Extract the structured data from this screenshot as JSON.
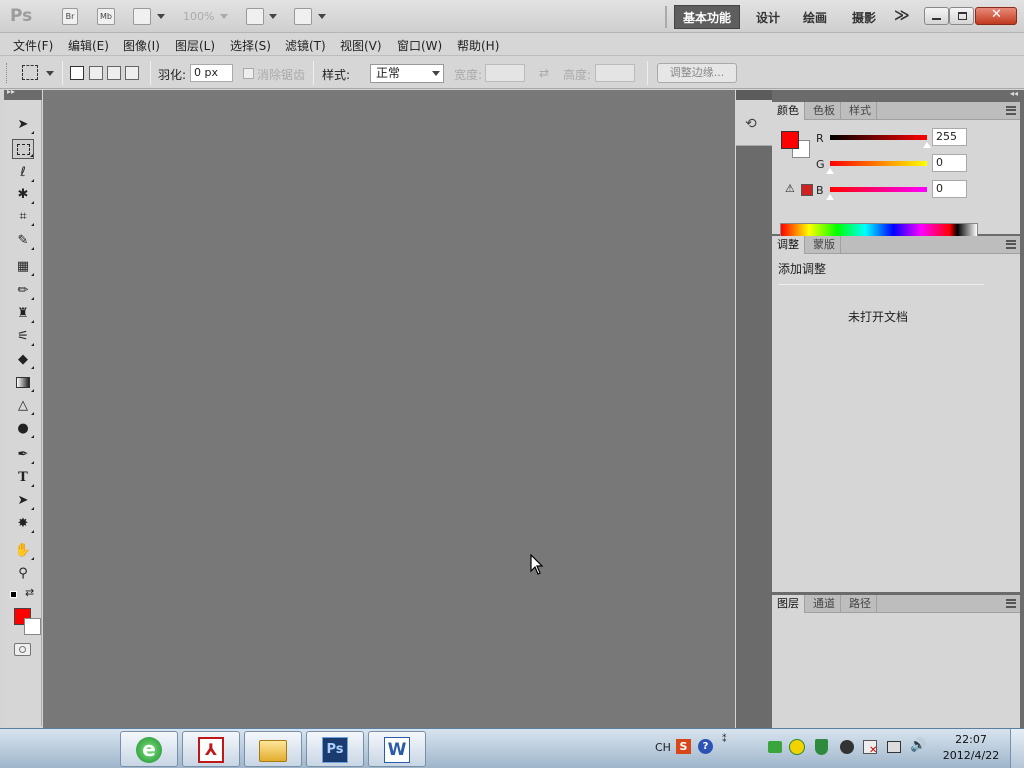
{
  "appbar": {
    "logo": "Ps",
    "br_label": "Br",
    "mb_label": "Mb",
    "zoom": "100%",
    "workspaces": [
      "基本功能",
      "设计",
      "绘画",
      "摄影"
    ],
    "more": "≫"
  },
  "menu": [
    "文件(F)",
    "编辑(E)",
    "图像(I)",
    "图层(L)",
    "选择(S)",
    "滤镜(T)",
    "视图(V)",
    "窗口(W)",
    "帮助(H)"
  ],
  "options": {
    "feather_label": "羽化:",
    "feather_value": "0 px",
    "antialias_label": "消除锯齿",
    "style_label": "样式:",
    "style_value": "正常",
    "width_label": "宽度:",
    "height_label": "高度:",
    "refine_edge": "调整边缘..."
  },
  "color_panel": {
    "tabs": [
      "颜色",
      "色板",
      "样式"
    ],
    "channels": [
      {
        "label": "R",
        "value": "255",
        "fraction": 1.0
      },
      {
        "label": "G",
        "value": "0",
        "fraction": 0.0
      },
      {
        "label": "B",
        "value": "0",
        "fraction": 0.0
      }
    ],
    "foreground_color": "#ff0000",
    "background_color": "#ffffff"
  },
  "adjust_panel": {
    "tabs": [
      "调整",
      "蒙版"
    ],
    "title": "添加调整",
    "message": "未打开文档"
  },
  "layers_panel": {
    "tabs": [
      "图层",
      "通道",
      "路径"
    ]
  },
  "taskbar": {
    "ime": "CH",
    "time": "22:07",
    "date": "2012/4/22"
  }
}
